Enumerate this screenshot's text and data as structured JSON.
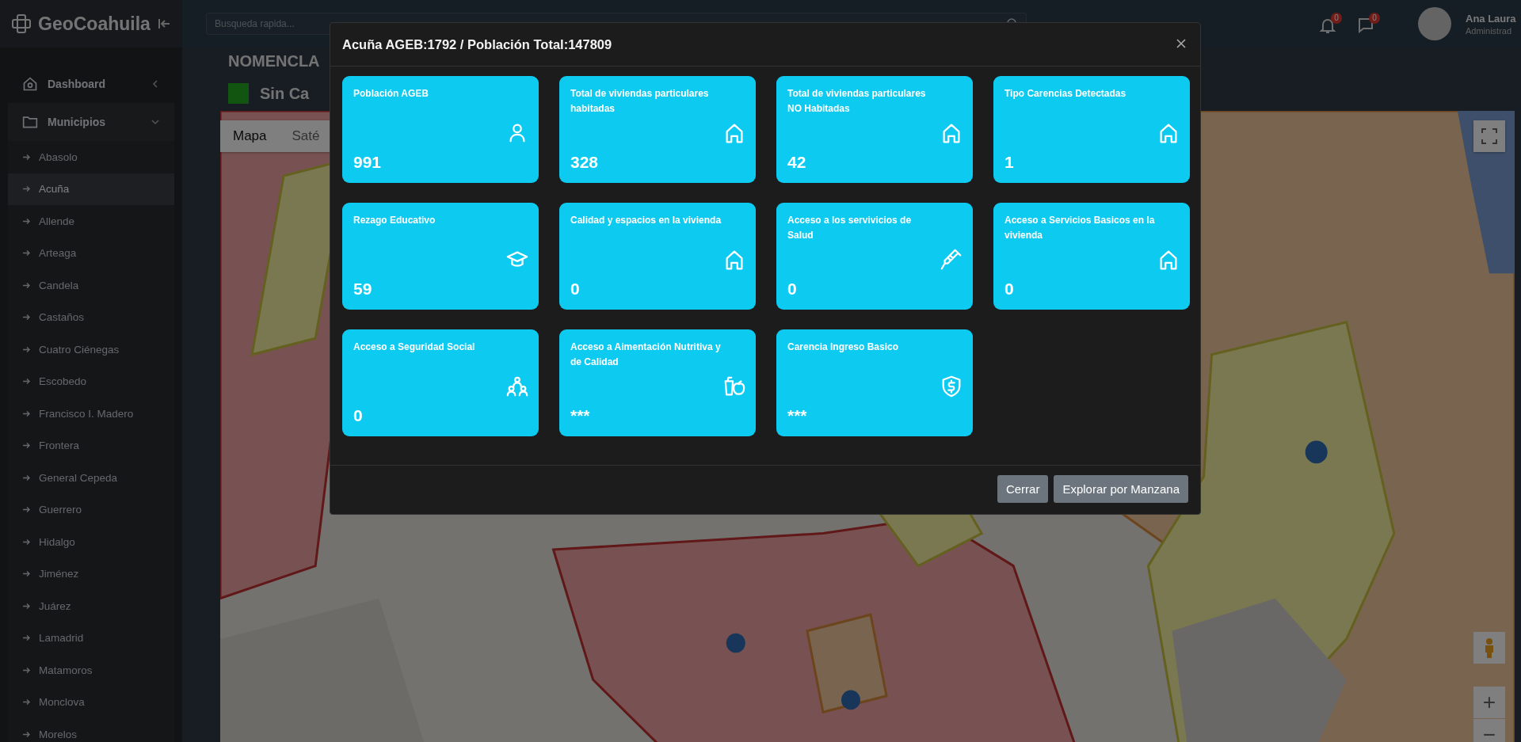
{
  "sidebar": {
    "brand": "GeoCoahuila",
    "items": [
      {
        "label": "Dashboard",
        "expanded": false
      },
      {
        "label": "Municipios",
        "expanded": true,
        "children": [
          {
            "label": "Abasolo",
            "selected": false
          },
          {
            "label": "Acuña",
            "selected": true
          },
          {
            "label": "Allende",
            "selected": false
          },
          {
            "label": "Arteaga",
            "selected": false
          },
          {
            "label": "Candela",
            "selected": false
          },
          {
            "label": "Castaños",
            "selected": false
          },
          {
            "label": "Cuatro Ciénegas",
            "selected": false
          },
          {
            "label": "Escobedo",
            "selected": false
          },
          {
            "label": "Francisco I. Madero",
            "selected": false
          },
          {
            "label": "Frontera",
            "selected": false
          },
          {
            "label": "General Cepeda",
            "selected": false
          },
          {
            "label": "Guerrero",
            "selected": false
          },
          {
            "label": "Hidalgo",
            "selected": false
          },
          {
            "label": "Jiménez",
            "selected": false
          },
          {
            "label": "Juárez",
            "selected": false
          },
          {
            "label": "Lamadrid",
            "selected": false
          },
          {
            "label": "Matamoros",
            "selected": false
          },
          {
            "label": "Monclova",
            "selected": false
          },
          {
            "label": "Morelos",
            "selected": false
          }
        ]
      }
    ]
  },
  "header": {
    "search": {
      "placeholder": "Busqueda rapida..."
    },
    "notifications": "0",
    "messages": "0",
    "user": {
      "name": "Ana Laura",
      "role": "Administrad"
    }
  },
  "page": {
    "title": "NOMENCLA",
    "legend": {
      "label": "Sin Ca"
    },
    "map": {
      "types": [
        {
          "label": "Mapa",
          "selected": true
        },
        {
          "label": "Saté",
          "selected": false
        }
      ],
      "zoom_in": "+",
      "zoom_out": "−"
    }
  },
  "modal": {
    "title": "Acuña AGEB:1792 / Población Total:147809",
    "cards": [
      {
        "title": "Población AGEB",
        "value": "991",
        "kind": "person"
      },
      {
        "title": "Total de viviendas particulares habitadas",
        "value": "328",
        "kind": "house"
      },
      {
        "title": "Total de viviendas particulares NO Habitadas",
        "value": "42",
        "kind": "house"
      },
      {
        "title": "Tipo Carencias Detectadas",
        "value": "1",
        "kind": "house"
      },
      {
        "title": "Rezago Educativo",
        "value": "59",
        "kind": "education"
      },
      {
        "title": "Calidad y espacios en la vivienda",
        "value": "0",
        "kind": "house"
      },
      {
        "title": "Acceso a los servivicios de Salud",
        "value": "0",
        "kind": "health"
      },
      {
        "title": "Acceso a Servicios Basicos en la vivienda",
        "value": "0",
        "kind": "house"
      },
      {
        "title": "Acceso a Seguridad Social",
        "value": "0",
        "kind": "social"
      },
      {
        "title": "Acceso a Aimentación Nutritiva y de Calidad",
        "value": "***",
        "kind": "food"
      },
      {
        "title": "Carencia Ingreso Basico",
        "value": "***",
        "kind": "income"
      }
    ],
    "buttons": [
      "Cerrar",
      "Explorar por Manzana"
    ]
  }
}
